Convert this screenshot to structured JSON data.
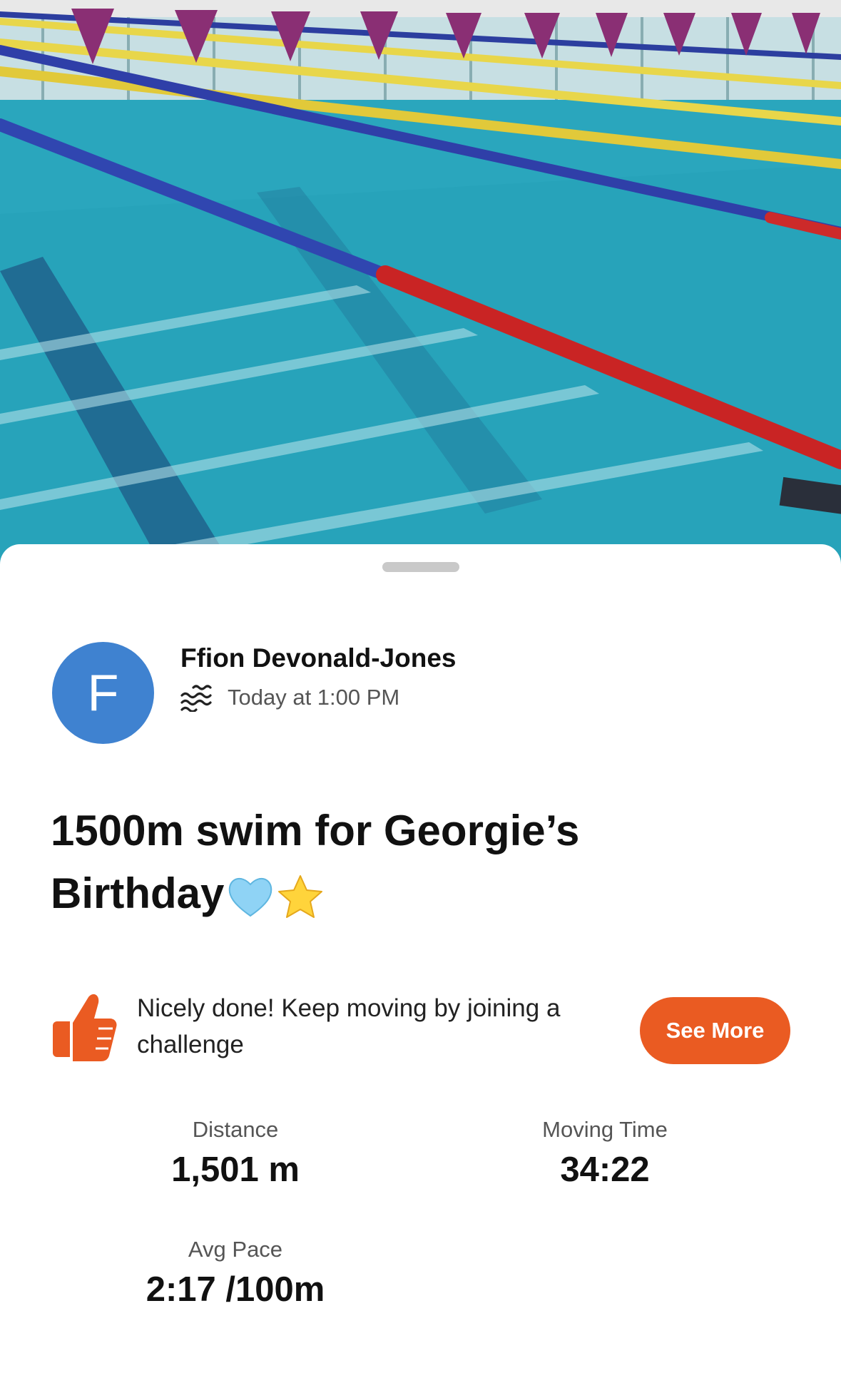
{
  "hero": {
    "image": "swimming-pool-photo",
    "alt_icon": "pool-lanes"
  },
  "activity": {
    "avatar_initial": "F",
    "athlete_name": "Ffion Devonald-Jones",
    "sport_icon": "swim-icon",
    "time": "Today at 1:00 PM",
    "title": "1500m swim for Georgie’s Birthday",
    "title_emojis": [
      "light-blue-heart",
      "star"
    ]
  },
  "kudos_prompt": {
    "icon": "thumbs-up-icon",
    "text": "Nicely done! Keep moving by joining a challenge",
    "button_label": "See More"
  },
  "stats": [
    {
      "label": "Distance",
      "value": "1,501 m"
    },
    {
      "label": "Moving Time",
      "value": "34:22"
    },
    {
      "label": "Avg Pace",
      "value": "2:17 /100m"
    }
  ],
  "colors": {
    "accent": "#ea5b22",
    "avatar": "#3f82d0"
  }
}
